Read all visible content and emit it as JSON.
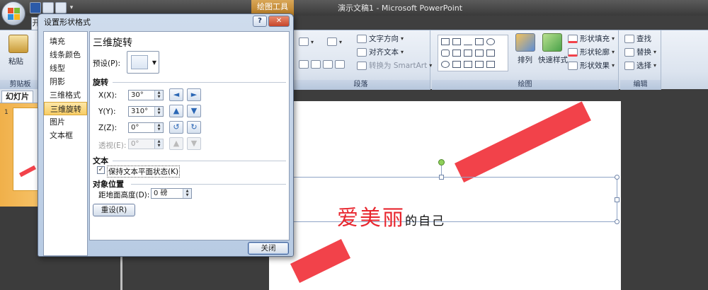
{
  "app": {
    "title": "演示文稿1 - Microsoft PowerPoint",
    "context_tab": "绘图工具",
    "qat_dropdown": "▾",
    "tab_start": "开"
  },
  "ribbon": {
    "paste": "粘贴",
    "clipboard_group": "剪贴板",
    "paragraph_group": "段落",
    "drawing_group": "绘图",
    "editing_group": "编辑",
    "text_direction": "文字方向",
    "align_text": "对齐文本",
    "convert_smartart": "转换为 SmartArt",
    "arrange": "排列",
    "quick_styles": "快速样式",
    "shape_fill": "形状填充",
    "shape_outline": "形状轮廓",
    "shape_effects": "形状效果",
    "find": "查找",
    "replace": "替换",
    "select": "选择"
  },
  "left_pane": {
    "tab_slides": "幻灯片",
    "slide_number": "1"
  },
  "dialog": {
    "title": "设置形状格式",
    "help": "?",
    "close_x": "✕",
    "nav": [
      "填充",
      "线条颜色",
      "线型",
      "阴影",
      "三维格式",
      "三维旋转",
      "图片",
      "文本框"
    ],
    "selected_nav": "三维旋转",
    "section_title": "三维旋转",
    "preset_label": "预设(P):",
    "rotation_header": "旋转",
    "x_label": "X(X):",
    "x_value": "30°",
    "y_label": "Y(Y):",
    "y_value": "310°",
    "z_label": "Z(Z):",
    "z_value": "0°",
    "perspective_label": "透视(E):",
    "perspective_value": "0°",
    "text_header": "文本",
    "keep_text_flat": "保持文本平面状态(K)",
    "keep_text_flat_checked": "✓",
    "object_position_header": "对象位置",
    "distance_label": "距地面高度(D):",
    "distance_value": "0 磅",
    "reset_button": "重设(R)",
    "close_button": "关闭"
  },
  "slide": {
    "text_red": "爱美丽",
    "text_black": "的自己",
    "stripe_color": "#f2424a"
  }
}
